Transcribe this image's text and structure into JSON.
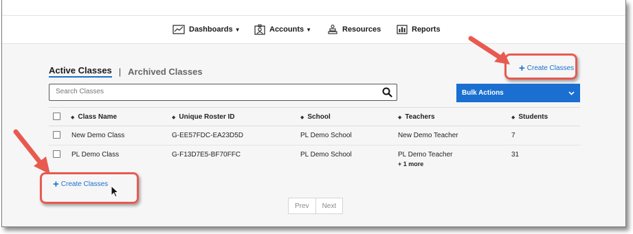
{
  "nav": {
    "items": [
      {
        "label": "Dashboards",
        "icon": "chart-icon",
        "dropdown": true
      },
      {
        "label": "Accounts",
        "icon": "accounts-icon",
        "dropdown": true
      },
      {
        "label": "Resources",
        "icon": "resources-icon",
        "dropdown": false
      },
      {
        "label": "Reports",
        "icon": "bar-chart-icon",
        "dropdown": false
      }
    ]
  },
  "tabs": {
    "active": "Active Classes",
    "separator": "|",
    "inactive": "Archived Classes"
  },
  "create_classes_label": "Create Classes",
  "search": {
    "placeholder": "Search Classes"
  },
  "bulk_actions": {
    "label": "Bulk Actions"
  },
  "table": {
    "headers": [
      "Class Name",
      "Unique Roster ID",
      "School",
      "Teachers",
      "Students"
    ],
    "rows": [
      {
        "class_name": "New Demo Class",
        "roster_id": "G-EE57FDC-EA23D5D",
        "school": "PL Demo School",
        "teachers": "New Demo Teacher",
        "more": "",
        "students": "7"
      },
      {
        "class_name": "PL Demo Class",
        "roster_id": "G-F13D7E5-BF70FFC",
        "school": "PL Demo School",
        "teachers": "PL Demo Teacher",
        "more": "+ 1 more",
        "students": "31"
      }
    ]
  },
  "pagination": {
    "prev": "Prev",
    "next": "Next"
  },
  "colors": {
    "accent": "#1a6fd1",
    "annotation": "#e85a4f"
  }
}
